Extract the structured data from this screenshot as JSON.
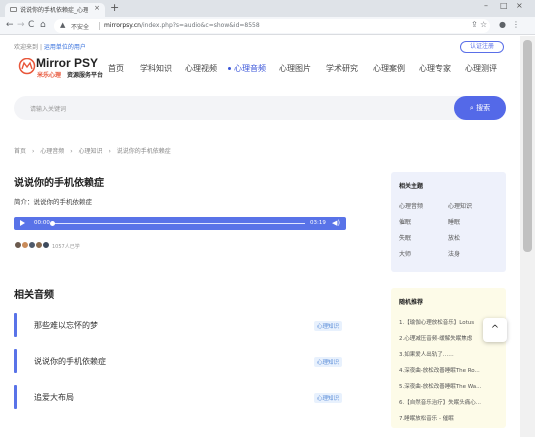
{
  "browser": {
    "tab_title": "说说你的手机依赖症_心理知识",
    "tab_close": "×",
    "new_tab": "+",
    "window_controls": [
      "–",
      "□",
      "×"
    ],
    "nav": {
      "back": "←",
      "forward": "→",
      "reload": "C",
      "home": "⌂"
    },
    "security_icon": "warning-triangle",
    "security_label": "不安全",
    "url_host": "mirrorpsy.cn",
    "url_rest": "/index.php?s=audio&c=show&id=8558",
    "toolbar_icons": [
      "share-icon",
      "star-icon",
      "profile-icon",
      "more-icon"
    ]
  },
  "site": {
    "welcome": {
      "prefix": "欢迎来到",
      "sep": "|",
      "link": "运用单位的用户"
    },
    "auth_button": "认证注册",
    "logo": {
      "name": "Mirror PSY",
      "sub1": "米乐心理",
      "sub2": "资源服务平台"
    },
    "menu": [
      "首页",
      "学科知识",
      "心理视频",
      "心理音频",
      "心理图片",
      "学术研究",
      "心理案例",
      "心理专家",
      "心理测评"
    ],
    "active_menu": "心理音频",
    "accent_color": "#5469e8"
  },
  "search": {
    "placeholder": "请输入关键词",
    "button": "搜索",
    "button_icon": "search-icon"
  },
  "breadcrumb": [
    "首页",
    "›",
    "心理音频",
    "›",
    "心理知识",
    "›",
    "说说你的手机依赖症"
  ],
  "article": {
    "title": "说说你的手机依赖症",
    "intro": "简介：说说你的手机依赖症",
    "player": {
      "current": "00:00",
      "duration": "03:19",
      "progress": 0
    },
    "listeners": "1057人已学"
  },
  "related": {
    "heading": "相关音频",
    "items": [
      {
        "name": "那些难以忘怀的梦",
        "tag": "心理知识"
      },
      {
        "name": "说说你的手机依赖症",
        "tag": "心理知识"
      },
      {
        "name": "追爱大布局",
        "tag": "心理知识"
      }
    ]
  },
  "tags_panel": {
    "heading": "相关主题",
    "tags": [
      "心理音频",
      "心理知识",
      "催眠",
      "睡眠",
      "失眠",
      "放松",
      "大师",
      "法身"
    ]
  },
  "recommend": {
    "heading": "随机推荐",
    "items": [
      "1.【瑜伽心理放松音乐】Lotus",
      "2.心理减压音频-缓解失眠焦虑",
      "3.如果爱人出轨了……",
      "4.深夜曲-放松改善睡眠The Ro...",
      "5.深夜曲-放松改善睡眠The Wa...",
      "6.【自然音乐治疗】失眠头痛心...",
      "7.睡眠放松音乐 - 催眠"
    ]
  },
  "back_to_top": "^"
}
